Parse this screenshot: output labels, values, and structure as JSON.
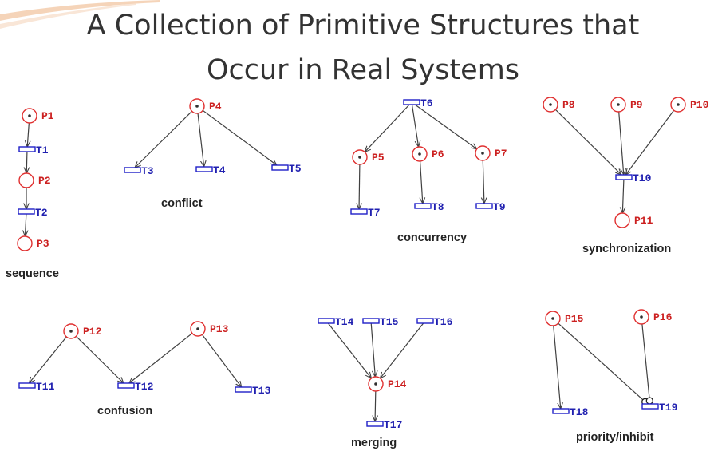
{
  "title": {
    "line1": "A Collection of Primitive Structures that",
    "line2": "Occur in Real Systems"
  },
  "colors": {
    "place": "#e03030",
    "token": "#303030",
    "transition": "#2020c8",
    "arc": "#404040",
    "label_place": "#cc2020",
    "label_transition": "#2020b0"
  },
  "captions": {
    "sequence": "sequence",
    "conflict": "conflict",
    "concurrency": "concurrency",
    "synchronization": "synchronization",
    "confusion": "confusion",
    "merging": "merging",
    "priority": "priority/inhibit"
  },
  "nets": {
    "sequence": {
      "places": [
        {
          "label": "P1",
          "token": true
        },
        {
          "label": "P2",
          "token": false
        },
        {
          "label": "P3",
          "token": false
        }
      ],
      "transitions": [
        {
          "label": "T1"
        },
        {
          "label": "T2"
        }
      ]
    },
    "conflict": {
      "places": [
        {
          "label": "P4",
          "token": true
        }
      ],
      "transitions": [
        {
          "label": "T3"
        },
        {
          "label": "T4"
        },
        {
          "label": "T5"
        }
      ]
    },
    "concurrency": {
      "places": [
        {
          "label": "P5",
          "token": true
        },
        {
          "label": "P6",
          "token": true
        },
        {
          "label": "P7",
          "token": true
        }
      ],
      "transitions": [
        {
          "label": "T6"
        },
        {
          "label": "T7"
        },
        {
          "label": "T8"
        },
        {
          "label": "T9"
        }
      ]
    },
    "synchronization": {
      "places": [
        {
          "label": "P8",
          "token": true
        },
        {
          "label": "P9",
          "token": true
        },
        {
          "label": "P10",
          "token": true
        },
        {
          "label": "P11",
          "token": false
        }
      ],
      "transitions": [
        {
          "label": "T10"
        }
      ]
    },
    "confusion": {
      "places": [
        {
          "label": "P12",
          "token": true
        },
        {
          "label": "P13",
          "token": true
        }
      ],
      "transitions": [
        {
          "label": "T11"
        },
        {
          "label": "T12"
        },
        {
          "label": "T13"
        }
      ]
    },
    "merging": {
      "places": [
        {
          "label": "P14",
          "token": true
        }
      ],
      "transitions": [
        {
          "label": "T14"
        },
        {
          "label": "T15"
        },
        {
          "label": "T16"
        },
        {
          "label": "T17"
        }
      ]
    },
    "priority": {
      "places": [
        {
          "label": "P15",
          "token": true
        },
        {
          "label": "P16",
          "token": true
        }
      ],
      "transitions": [
        {
          "label": "T18"
        },
        {
          "label": "T19"
        }
      ]
    }
  }
}
